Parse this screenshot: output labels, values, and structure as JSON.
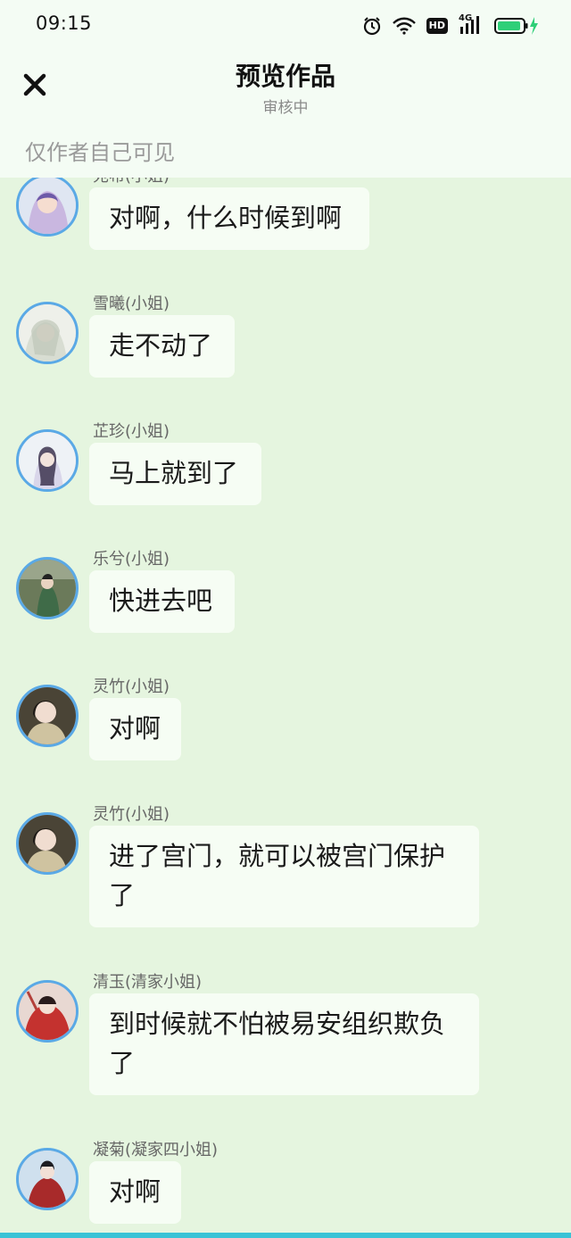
{
  "status_bar": {
    "time": "09:15",
    "network_label": "4G",
    "hd_label": "HD"
  },
  "header": {
    "title": "预览作品",
    "subtitle": "审核中",
    "notice": "仅作者自己可见"
  },
  "messages": [
    {
      "sender": "宛希(小姐)",
      "text": "对啊，什么时候到啊"
    },
    {
      "sender": "雪曦(小姐)",
      "text": "走不动了"
    },
    {
      "sender": "芷珍(小姐)",
      "text": "马上就到了"
    },
    {
      "sender": "乐兮(小姐)",
      "text": "快进去吧"
    },
    {
      "sender": "灵竹(小姐)",
      "text": "对啊"
    },
    {
      "sender": "灵竹(小姐)",
      "text": "进了宫门，就可以被宫门保护了"
    },
    {
      "sender": "清玉(清家小姐)",
      "text": "到时候就不怕被易安组织欺负了"
    },
    {
      "sender": "凝菊(凝家四小姐)",
      "text": "对啊"
    }
  ],
  "colors": {
    "chat_background": "#e5f5df",
    "header_background": "#f4fcf4",
    "bubble_background": "#f6fdf4",
    "avatar_ring": "#5aa9e6",
    "battery_charge": "#2fcf78"
  }
}
